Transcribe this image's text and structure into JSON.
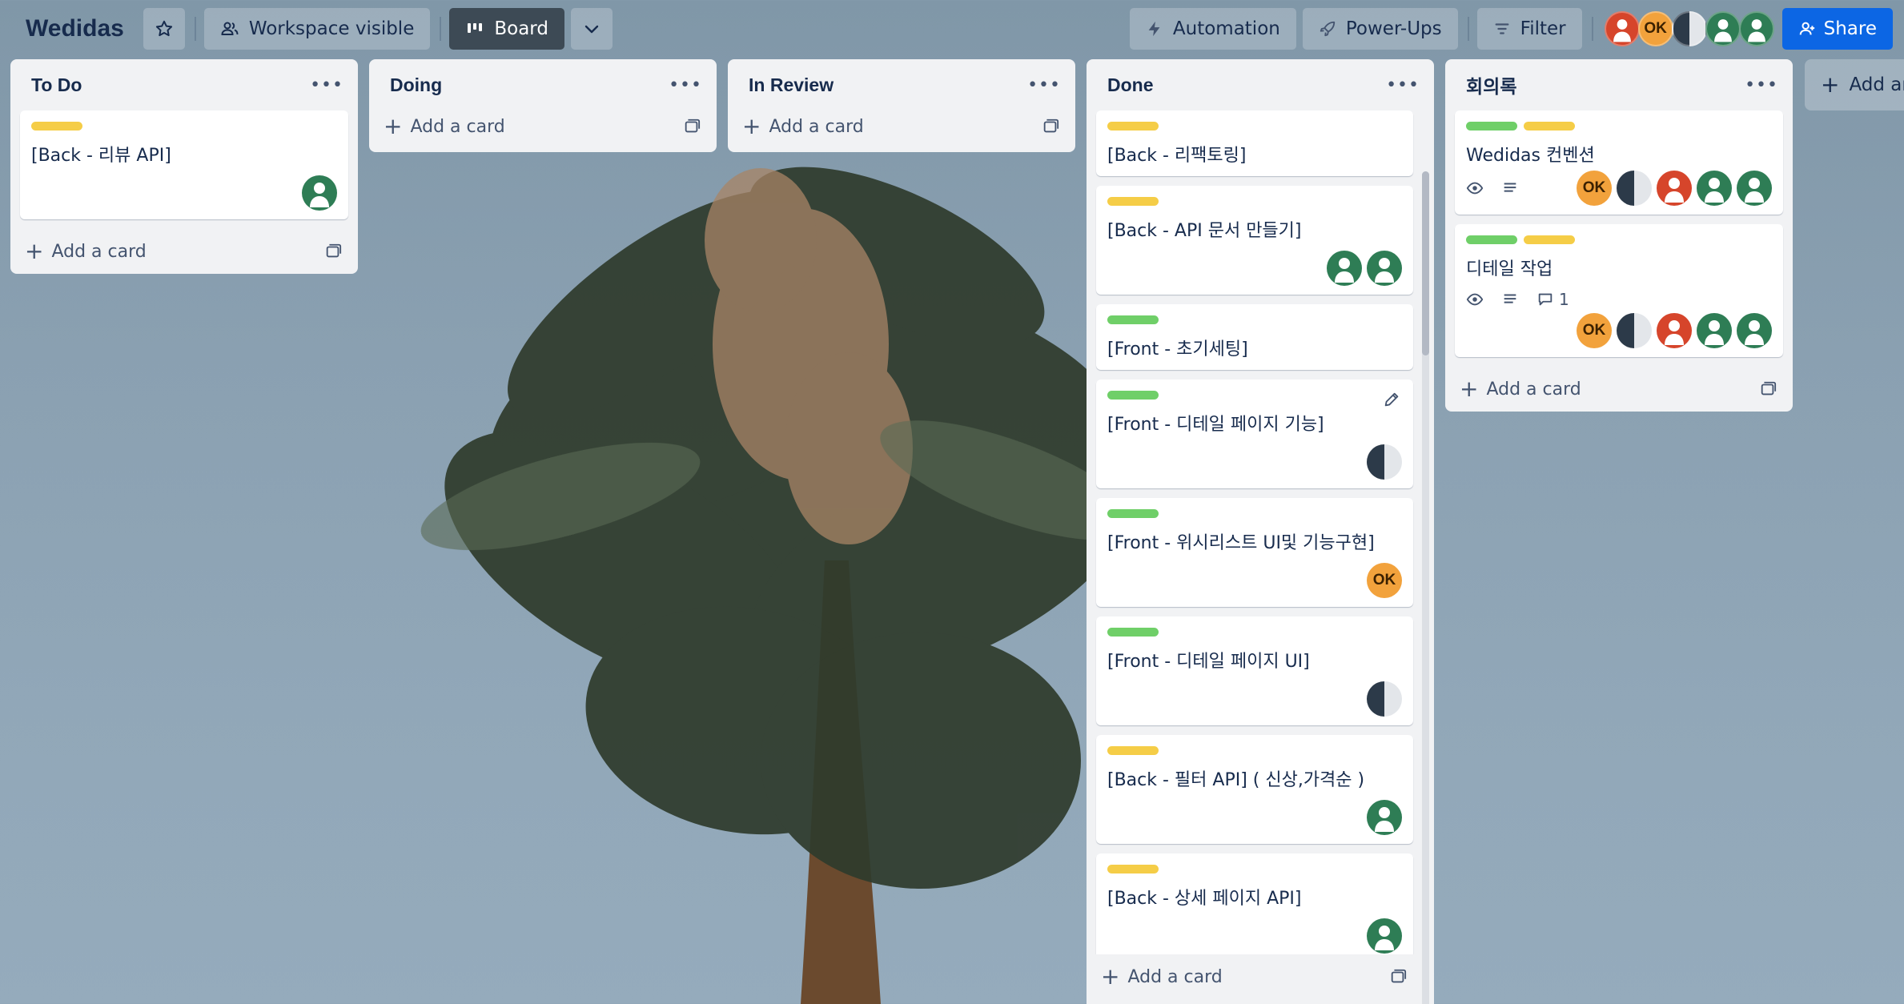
{
  "board": {
    "title": "Wedidas"
  },
  "toolbar": {
    "visibility_label": "Workspace visible",
    "view_label": "Board",
    "automation_label": "Automation",
    "powerups_label": "Power-Ups",
    "filter_label": "Filter",
    "share_label": "Share"
  },
  "members": [
    {
      "color": "red",
      "initials": ""
    },
    {
      "color": "orange",
      "initials": "OK"
    },
    {
      "color": "half",
      "initials": ""
    },
    {
      "color": "green",
      "initials": ""
    },
    {
      "color": "green",
      "initials": ""
    }
  ],
  "lists": [
    {
      "title": "To Do",
      "add_label": "Add a card",
      "cards": [
        {
          "labels": [
            "yellow"
          ],
          "text": "[Back - 리뷰 API]",
          "members": [
            "green"
          ]
        }
      ]
    },
    {
      "title": "Doing",
      "add_label": "Add a card",
      "cards": []
    },
    {
      "title": "In Review",
      "add_label": "Add a card",
      "cards": []
    },
    {
      "title": "Done",
      "add_label": "Add a card",
      "cards": [
        {
          "labels": [
            "yellow"
          ],
          "text": "[Back - 리팩토링]",
          "members": []
        },
        {
          "labels": [
            "yellow"
          ],
          "text": "[Back - API 문서 만들기]",
          "members": [
            "green",
            "green"
          ]
        },
        {
          "labels": [
            "green"
          ],
          "text": "[Front - 초기세팅]",
          "members": []
        },
        {
          "labels": [
            "green"
          ],
          "text": "[Front - 디테일 페이지 기능]",
          "members": [
            "half"
          ],
          "editing": true
        },
        {
          "labels": [
            "green"
          ],
          "text": "[Front - 위시리스트 UI및 기능구현]",
          "members": [
            "orange"
          ]
        },
        {
          "labels": [
            "green"
          ],
          "text": "[Front - 디테일 페이지 UI]",
          "members": [
            "half"
          ]
        },
        {
          "labels": [
            "yellow"
          ],
          "text": "[Back - 필터 API] ( 신상,가격순 )",
          "members": [
            "green"
          ]
        },
        {
          "labels": [
            "yellow"
          ],
          "text": "[Back - 상세 페이지 API]",
          "members": [
            "green"
          ]
        }
      ]
    },
    {
      "title": "회의록",
      "add_label": "Add a card",
      "cards": [
        {
          "labels": [
            "green",
            "yellow"
          ],
          "text": "Wedidas 컨벤션",
          "members": [
            "orange",
            "half",
            "red",
            "green",
            "green"
          ],
          "badges": {
            "watch": true,
            "description": true,
            "comments": ""
          }
        },
        {
          "labels": [
            "green",
            "yellow"
          ],
          "text": "디테일 작업",
          "members": [
            "orange",
            "half",
            "red",
            "green",
            "green"
          ],
          "badges": {
            "watch": true,
            "description": true,
            "comments": "1"
          }
        }
      ]
    }
  ],
  "add_list_label": "Add another list",
  "avatar_initials": "OK",
  "colors": {
    "accent": "#0c66e4",
    "label_yellow": "#f5cd47",
    "label_green": "#6fcf68",
    "list_bg": "#f1f2f4"
  }
}
